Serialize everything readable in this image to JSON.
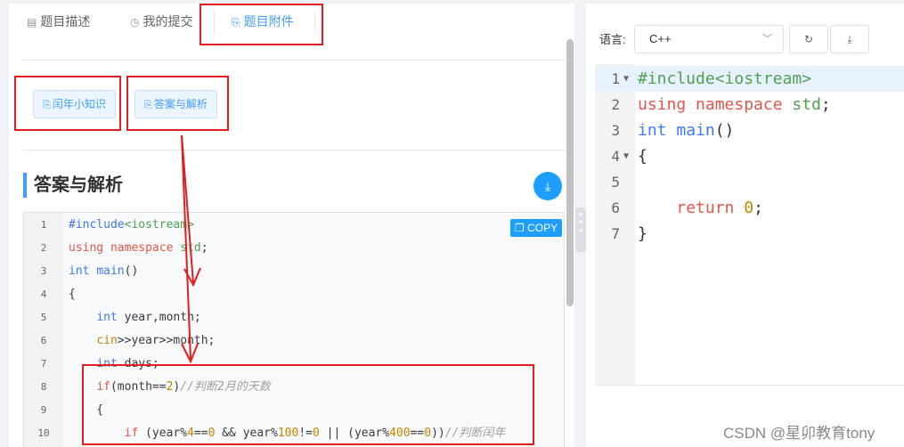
{
  "tabs": [
    {
      "label": "题目描述",
      "icon": "description-icon"
    },
    {
      "label": "我的提交",
      "icon": "clock-icon"
    },
    {
      "label": "题目附件",
      "icon": "file-code-icon"
    }
  ],
  "attachments": [
    {
      "label": "闰年小知识"
    },
    {
      "label": "答案与解析"
    }
  ],
  "section_title": "答案与解析",
  "copy_label": "COPY",
  "answer_code": [
    {
      "n": "1",
      "text": "#include<iostream>"
    },
    {
      "n": "2",
      "text": "using namespace std;"
    },
    {
      "n": "3",
      "text": "int main()"
    },
    {
      "n": "4",
      "text": "{"
    },
    {
      "n": "5",
      "text": "    int year,month;"
    },
    {
      "n": "6",
      "text": "    cin>>year>>month;"
    },
    {
      "n": "7",
      "text": "    int days;"
    },
    {
      "n": "8",
      "text": "    if(month==2)//判断2月的天数"
    },
    {
      "n": "9",
      "text": "    {"
    },
    {
      "n": "10",
      "text": "        if (year%4==0 && year%100!=0 || (year%400==0))//判断闰年"
    }
  ],
  "editor": {
    "language_label": "语言:",
    "language_value": "C++",
    "lines": [
      {
        "n": "1",
        "text": "#include<iostream>"
      },
      {
        "n": "2",
        "text": "using namespace std;"
      },
      {
        "n": "3",
        "text": "int main()"
      },
      {
        "n": "4",
        "text": "{"
      },
      {
        "n": "5",
        "text": ""
      },
      {
        "n": "6",
        "text": "    return 0;"
      },
      {
        "n": "7",
        "text": "}"
      }
    ]
  },
  "watermark": "CSDN @星卯教育tony",
  "colors": {
    "accent": "#409eff",
    "annotation_red": "#e02020",
    "copy_button": "#1e9fff"
  }
}
